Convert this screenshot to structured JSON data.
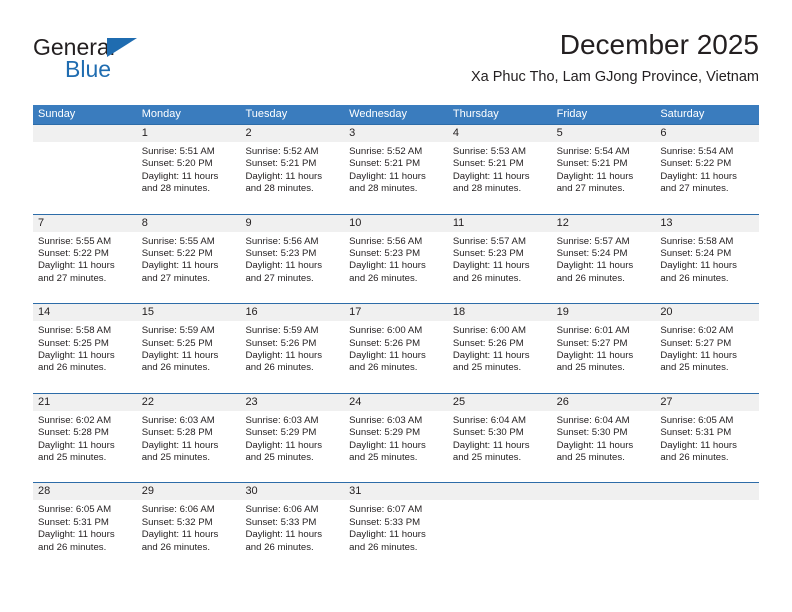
{
  "brand": {
    "name_top": "General",
    "name_bottom": "Blue",
    "accent_color": "#1f6cb0"
  },
  "header": {
    "title": "December 2025",
    "subtitle": "Xa Phuc Tho, Lam GJong Province, Vietnam"
  },
  "theme": {
    "header_bar_color": "#3a7cbe",
    "week_rule_color": "#2d6ca8",
    "day_number_band_color": "#f0f0f0",
    "text_color": "#231f20"
  },
  "weekdays": [
    "Sunday",
    "Monday",
    "Tuesday",
    "Wednesday",
    "Thursday",
    "Friday",
    "Saturday"
  ],
  "weeks": [
    [
      {
        "day": "",
        "sunrise": "",
        "sunset": "",
        "daylight": ""
      },
      {
        "day": "1",
        "sunrise": "Sunrise: 5:51 AM",
        "sunset": "Sunset: 5:20 PM",
        "daylight": "Daylight: 11 hours and 28 minutes."
      },
      {
        "day": "2",
        "sunrise": "Sunrise: 5:52 AM",
        "sunset": "Sunset: 5:21 PM",
        "daylight": "Daylight: 11 hours and 28 minutes."
      },
      {
        "day": "3",
        "sunrise": "Sunrise: 5:52 AM",
        "sunset": "Sunset: 5:21 PM",
        "daylight": "Daylight: 11 hours and 28 minutes."
      },
      {
        "day": "4",
        "sunrise": "Sunrise: 5:53 AM",
        "sunset": "Sunset: 5:21 PM",
        "daylight": "Daylight: 11 hours and 28 minutes."
      },
      {
        "day": "5",
        "sunrise": "Sunrise: 5:54 AM",
        "sunset": "Sunset: 5:21 PM",
        "daylight": "Daylight: 11 hours and 27 minutes."
      },
      {
        "day": "6",
        "sunrise": "Sunrise: 5:54 AM",
        "sunset": "Sunset: 5:22 PM",
        "daylight": "Daylight: 11 hours and 27 minutes."
      }
    ],
    [
      {
        "day": "7",
        "sunrise": "Sunrise: 5:55 AM",
        "sunset": "Sunset: 5:22 PM",
        "daylight": "Daylight: 11 hours and 27 minutes."
      },
      {
        "day": "8",
        "sunrise": "Sunrise: 5:55 AM",
        "sunset": "Sunset: 5:22 PM",
        "daylight": "Daylight: 11 hours and 27 minutes."
      },
      {
        "day": "9",
        "sunrise": "Sunrise: 5:56 AM",
        "sunset": "Sunset: 5:23 PM",
        "daylight": "Daylight: 11 hours and 27 minutes."
      },
      {
        "day": "10",
        "sunrise": "Sunrise: 5:56 AM",
        "sunset": "Sunset: 5:23 PM",
        "daylight": "Daylight: 11 hours and 26 minutes."
      },
      {
        "day": "11",
        "sunrise": "Sunrise: 5:57 AM",
        "sunset": "Sunset: 5:23 PM",
        "daylight": "Daylight: 11 hours and 26 minutes."
      },
      {
        "day": "12",
        "sunrise": "Sunrise: 5:57 AM",
        "sunset": "Sunset: 5:24 PM",
        "daylight": "Daylight: 11 hours and 26 minutes."
      },
      {
        "day": "13",
        "sunrise": "Sunrise: 5:58 AM",
        "sunset": "Sunset: 5:24 PM",
        "daylight": "Daylight: 11 hours and 26 minutes."
      }
    ],
    [
      {
        "day": "14",
        "sunrise": "Sunrise: 5:58 AM",
        "sunset": "Sunset: 5:25 PM",
        "daylight": "Daylight: 11 hours and 26 minutes."
      },
      {
        "day": "15",
        "sunrise": "Sunrise: 5:59 AM",
        "sunset": "Sunset: 5:25 PM",
        "daylight": "Daylight: 11 hours and 26 minutes."
      },
      {
        "day": "16",
        "sunrise": "Sunrise: 5:59 AM",
        "sunset": "Sunset: 5:26 PM",
        "daylight": "Daylight: 11 hours and 26 minutes."
      },
      {
        "day": "17",
        "sunrise": "Sunrise: 6:00 AM",
        "sunset": "Sunset: 5:26 PM",
        "daylight": "Daylight: 11 hours and 26 minutes."
      },
      {
        "day": "18",
        "sunrise": "Sunrise: 6:00 AM",
        "sunset": "Sunset: 5:26 PM",
        "daylight": "Daylight: 11 hours and 25 minutes."
      },
      {
        "day": "19",
        "sunrise": "Sunrise: 6:01 AM",
        "sunset": "Sunset: 5:27 PM",
        "daylight": "Daylight: 11 hours and 25 minutes."
      },
      {
        "day": "20",
        "sunrise": "Sunrise: 6:02 AM",
        "sunset": "Sunset: 5:27 PM",
        "daylight": "Daylight: 11 hours and 25 minutes."
      }
    ],
    [
      {
        "day": "21",
        "sunrise": "Sunrise: 6:02 AM",
        "sunset": "Sunset: 5:28 PM",
        "daylight": "Daylight: 11 hours and 25 minutes."
      },
      {
        "day": "22",
        "sunrise": "Sunrise: 6:03 AM",
        "sunset": "Sunset: 5:28 PM",
        "daylight": "Daylight: 11 hours and 25 minutes."
      },
      {
        "day": "23",
        "sunrise": "Sunrise: 6:03 AM",
        "sunset": "Sunset: 5:29 PM",
        "daylight": "Daylight: 11 hours and 25 minutes."
      },
      {
        "day": "24",
        "sunrise": "Sunrise: 6:03 AM",
        "sunset": "Sunset: 5:29 PM",
        "daylight": "Daylight: 11 hours and 25 minutes."
      },
      {
        "day": "25",
        "sunrise": "Sunrise: 6:04 AM",
        "sunset": "Sunset: 5:30 PM",
        "daylight": "Daylight: 11 hours and 25 minutes."
      },
      {
        "day": "26",
        "sunrise": "Sunrise: 6:04 AM",
        "sunset": "Sunset: 5:30 PM",
        "daylight": "Daylight: 11 hours and 25 minutes."
      },
      {
        "day": "27",
        "sunrise": "Sunrise: 6:05 AM",
        "sunset": "Sunset: 5:31 PM",
        "daylight": "Daylight: 11 hours and 26 minutes."
      }
    ],
    [
      {
        "day": "28",
        "sunrise": "Sunrise: 6:05 AM",
        "sunset": "Sunset: 5:31 PM",
        "daylight": "Daylight: 11 hours and 26 minutes."
      },
      {
        "day": "29",
        "sunrise": "Sunrise: 6:06 AM",
        "sunset": "Sunset: 5:32 PM",
        "daylight": "Daylight: 11 hours and 26 minutes."
      },
      {
        "day": "30",
        "sunrise": "Sunrise: 6:06 AM",
        "sunset": "Sunset: 5:33 PM",
        "daylight": "Daylight: 11 hours and 26 minutes."
      },
      {
        "day": "31",
        "sunrise": "Sunrise: 6:07 AM",
        "sunset": "Sunset: 5:33 PM",
        "daylight": "Daylight: 11 hours and 26 minutes."
      },
      {
        "day": "",
        "sunrise": "",
        "sunset": "",
        "daylight": ""
      },
      {
        "day": "",
        "sunrise": "",
        "sunset": "",
        "daylight": ""
      },
      {
        "day": "",
        "sunrise": "",
        "sunset": "",
        "daylight": ""
      }
    ]
  ]
}
